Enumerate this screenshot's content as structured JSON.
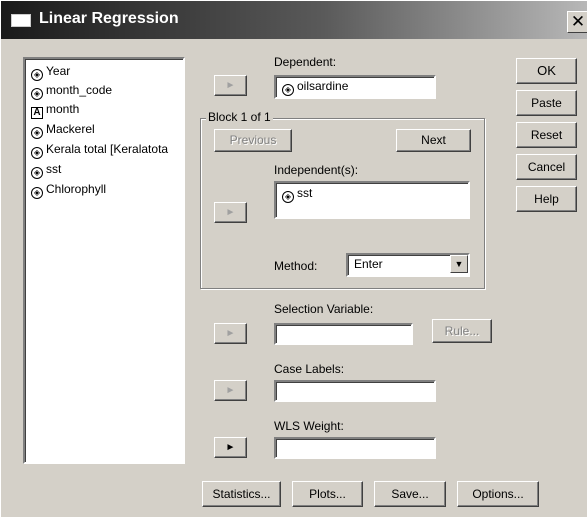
{
  "window": {
    "title": "Linear Regression",
    "close_glyph": "✕"
  },
  "variables": [
    {
      "label": "Year",
      "icon": "scale-variable-icon",
      "glyph": "◈"
    },
    {
      "label": "month_code",
      "icon": "scale-variable-icon",
      "glyph": "◈"
    },
    {
      "label": "month",
      "icon": "nominal-string-variable-icon",
      "glyph": "A"
    },
    {
      "label": "Mackerel",
      "icon": "scale-variable-icon",
      "glyph": "◈"
    },
    {
      "label": "Kerala total [Keralatota",
      "icon": "scale-variable-icon",
      "glyph": "◈"
    },
    {
      "label": "sst",
      "icon": "scale-variable-icon",
      "glyph": "◈"
    },
    {
      "label": "Chlorophyll",
      "icon": "scale-variable-icon",
      "glyph": "◈"
    }
  ],
  "dependent": {
    "label": "Dependent:",
    "value": "oilsardine",
    "glyph": "◈"
  },
  "block": {
    "title": "Block 1 of 1",
    "previous": "Previous",
    "next": "Next"
  },
  "independents": {
    "label": "Independent(s):",
    "items": [
      {
        "value": "sst",
        "glyph": "◈"
      }
    ]
  },
  "method": {
    "label": "Method:",
    "value": "Enter",
    "arrow": "▼"
  },
  "selection": {
    "label": "Selection Variable:",
    "rule": "Rule..."
  },
  "case_labels": {
    "label": "Case Labels:"
  },
  "wls": {
    "label": "WLS Weight:"
  },
  "arrow_glyph": "►",
  "side_buttons": {
    "ok": "OK",
    "paste": "Paste",
    "reset": "Reset",
    "cancel": "Cancel",
    "help": "Help"
  },
  "bottom_buttons": {
    "statistics": "Statistics...",
    "plots": "Plots...",
    "save": "Save...",
    "options": "Options..."
  }
}
